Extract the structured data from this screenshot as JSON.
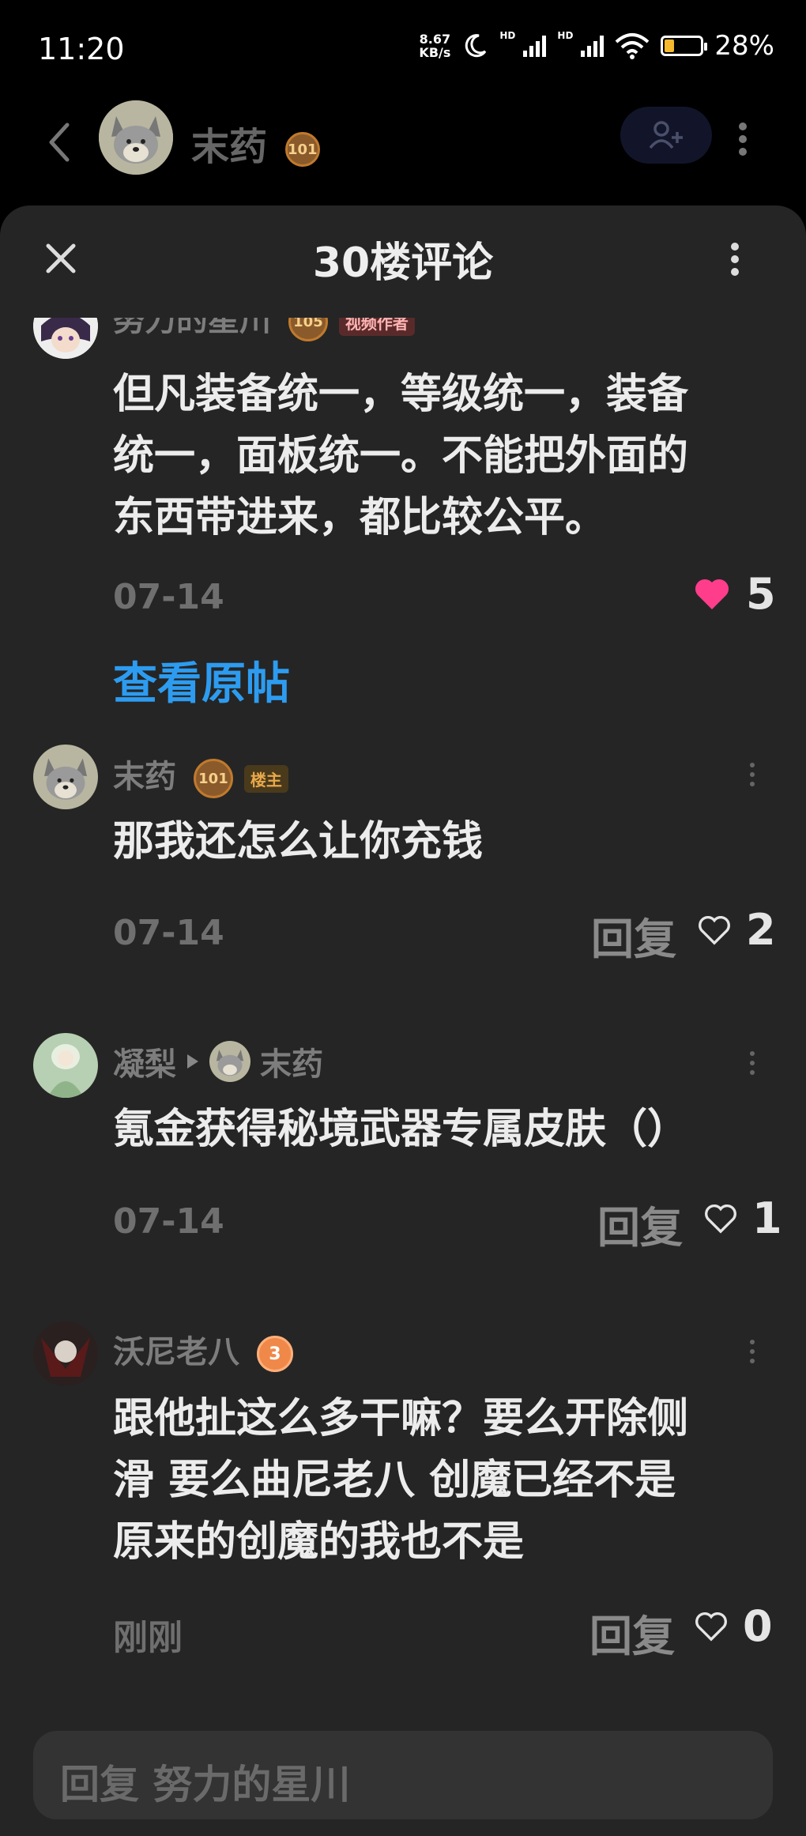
{
  "status_bar": {
    "time": "11:20",
    "net_speed_value": "8.67",
    "net_speed_unit": "KB/s",
    "signal_1_label": "HD",
    "signal_2_label": "HD",
    "battery_percent": "28%",
    "battery_level": 0.28,
    "icons": [
      "moon-icon",
      "signal-icon",
      "signal-icon",
      "wifi-icon",
      "battery-icon"
    ]
  },
  "header": {
    "user_name": "末药",
    "level": "101"
  },
  "sheet": {
    "title": "30楼评论"
  },
  "original_comment": {
    "author": "努力的星川",
    "level": "105",
    "tag": "视频作者",
    "text_lines": [
      "但凡装备统一，等级统一，装备",
      "统一，面板统一。不能把外面的",
      "东西带进来，都比较公平。"
    ],
    "date": "07-14",
    "likes": "5"
  },
  "view_post_label": "查看原帖",
  "replies": [
    {
      "author": "末药",
      "level": "101",
      "tag": "楼主",
      "text_lines": [
        "那我还怎么让你充钱"
      ],
      "date": "07-14",
      "reply_label": "回复",
      "likes": "2"
    },
    {
      "author": "凝梨",
      "reply_to": "末药",
      "text_lines": [
        "氪金获得秘境武器专属皮肤（）"
      ],
      "date": "07-14",
      "reply_label": "回复",
      "likes": "1"
    },
    {
      "author": "沃尼老八",
      "level": "3",
      "text_lines": [
        "跟他扯这么多干嘛？要么开除侧",
        "滑 要么曲尼老八 创魔已经不是",
        "原来的创魔的我也不是"
      ],
      "date": "刚刚",
      "reply_label": "回复",
      "likes": "0"
    }
  ],
  "input": {
    "placeholder": "回复 努力的星川"
  },
  "colors": {
    "sheet_bg": "#252525",
    "link_blue": "#2d9cf0",
    "heart_pink": "#ff3d8b",
    "battery_yellow": "#f5b82e"
  }
}
